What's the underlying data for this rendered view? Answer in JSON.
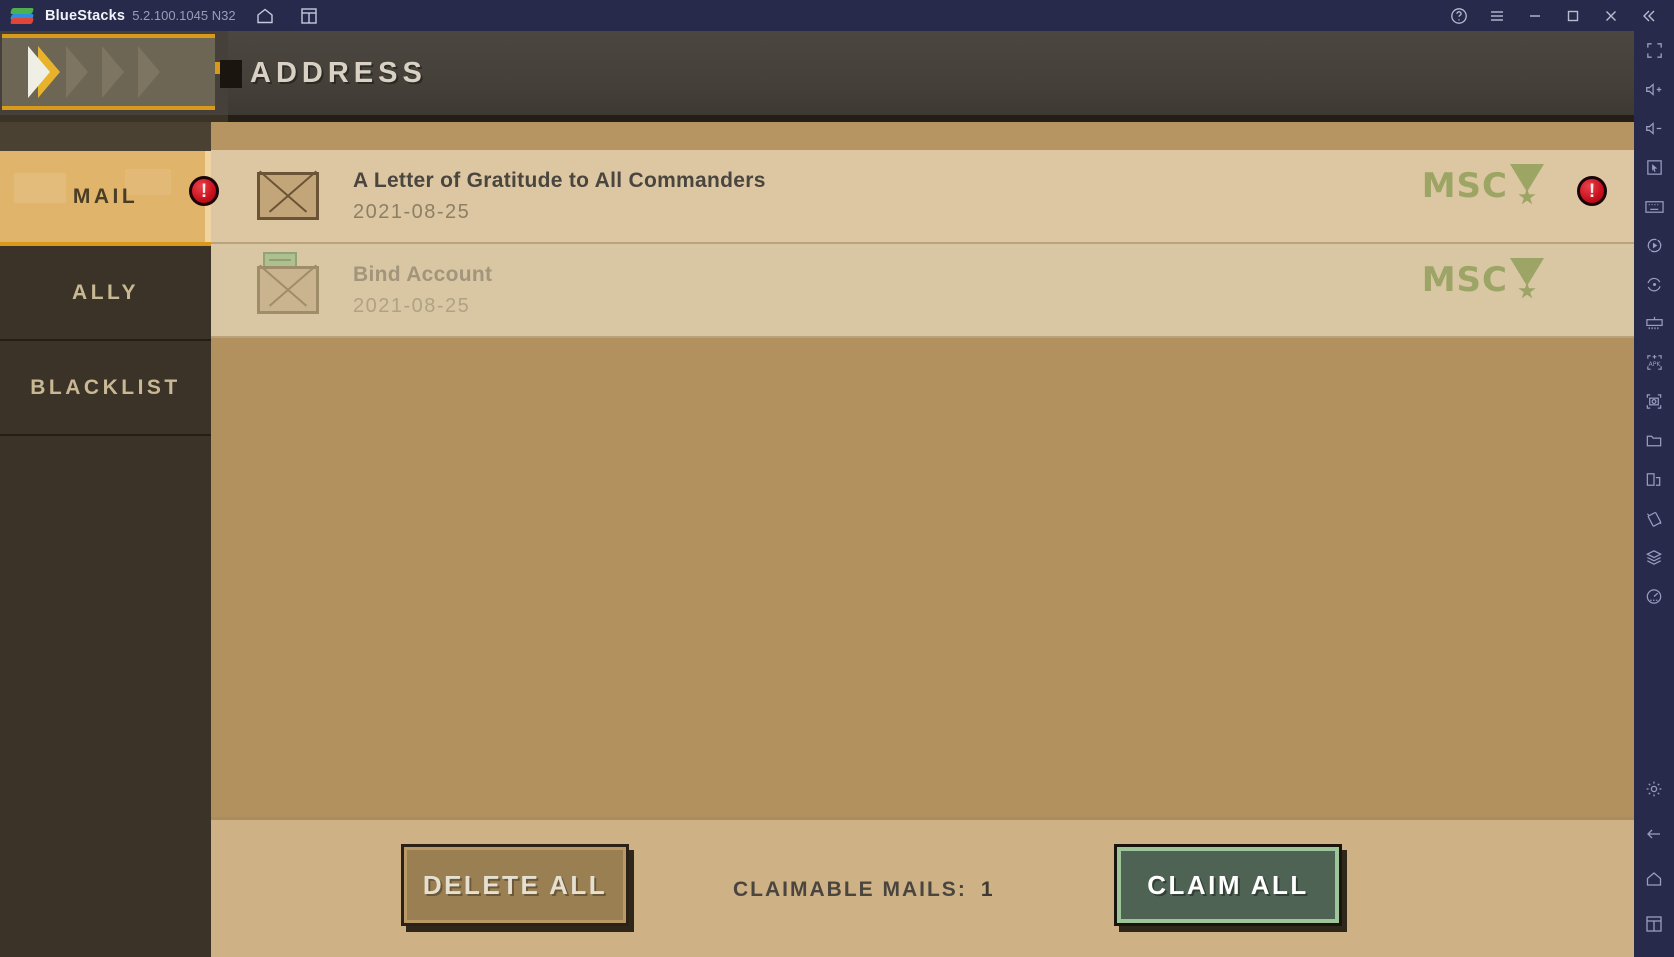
{
  "titlebar": {
    "app_name": "BlueStacks",
    "version": "5.2.100.1045 N32",
    "left_icons": [
      {
        "name": "home-icon",
        "label": "Home"
      },
      {
        "name": "multi-instance-icon",
        "label": "Instance Manager"
      }
    ],
    "right_icons": [
      {
        "name": "help-icon",
        "label": "Help"
      },
      {
        "name": "menu-icon",
        "label": "Menu"
      },
      {
        "name": "minimize-icon",
        "label": "Minimize"
      },
      {
        "name": "maximize-icon",
        "label": "Maximize"
      },
      {
        "name": "close-icon",
        "label": "Close"
      },
      {
        "name": "collapse-sidebar-icon",
        "label": "Collapse"
      }
    ]
  },
  "sidebar_right": {
    "icons": [
      {
        "name": "fullscreen-icon",
        "label": "Full screen"
      },
      {
        "name": "volume-up-icon",
        "label": "Volume up"
      },
      {
        "name": "volume-down-icon",
        "label": "Volume down"
      },
      {
        "name": "cursor-icon",
        "label": "Game controls"
      },
      {
        "name": "keyboard-icon",
        "label": "Keymapping"
      },
      {
        "name": "macro-record-icon",
        "label": "Macro recorder"
      },
      {
        "name": "rotate-icon",
        "label": "Rotate"
      },
      {
        "name": "multi-instance-sync-icon",
        "label": "Sync operations"
      },
      {
        "name": "install-apk-icon",
        "label": "Install APK"
      },
      {
        "name": "screenshot-icon",
        "label": "Screenshot"
      },
      {
        "name": "media-folder-icon",
        "label": "Media manager"
      },
      {
        "name": "copy-instance-icon",
        "label": "Multi-instance"
      },
      {
        "name": "shake-icon",
        "label": "Shake"
      },
      {
        "name": "layers-icon",
        "label": "Eco mode"
      },
      {
        "name": "performance-icon",
        "label": "Performance"
      },
      {
        "name": "gear-icon",
        "label": "Settings"
      },
      {
        "name": "back-arrow-icon",
        "label": "Back"
      },
      {
        "name": "home-nav-icon",
        "label": "Home"
      },
      {
        "name": "recents-icon",
        "label": "Recent apps"
      }
    ]
  },
  "game": {
    "header": {
      "title": "ADDRESS",
      "back_button_label": "Back"
    },
    "tabs": [
      {
        "id": "mail",
        "label": "MAIL",
        "active": true,
        "badge": "!"
      },
      {
        "id": "ally",
        "label": "ALLY",
        "active": false,
        "badge": ""
      },
      {
        "id": "blacklist",
        "label": "BLACKLIST",
        "active": false,
        "badge": ""
      }
    ],
    "mails": [
      {
        "subject": "A Letter of Gratitude to All Commanders",
        "date": "2021-08-25",
        "read": false,
        "sender_logo": "MSC",
        "badge": "!"
      },
      {
        "subject": "Bind Account",
        "date": "2021-08-25",
        "read": true,
        "sender_logo": "MSC",
        "badge": ""
      }
    ],
    "footer": {
      "delete_all_label": "DELETE ALL",
      "claimable_label": "CLAIMABLE MAILS:",
      "claimable_count": "1",
      "claim_all_label": "CLAIM ALL"
    }
  },
  "colors": {
    "titlebar_bg": "#272a4a",
    "panel_bg": "#b2915f",
    "row_bg": "#dcc7a2",
    "accent_gold": "#d99a1c",
    "tab_active": "#e0b46b",
    "claim_green": "#4e6353",
    "badge_red": "#c8101d",
    "logo_green": "#8c9c55"
  }
}
